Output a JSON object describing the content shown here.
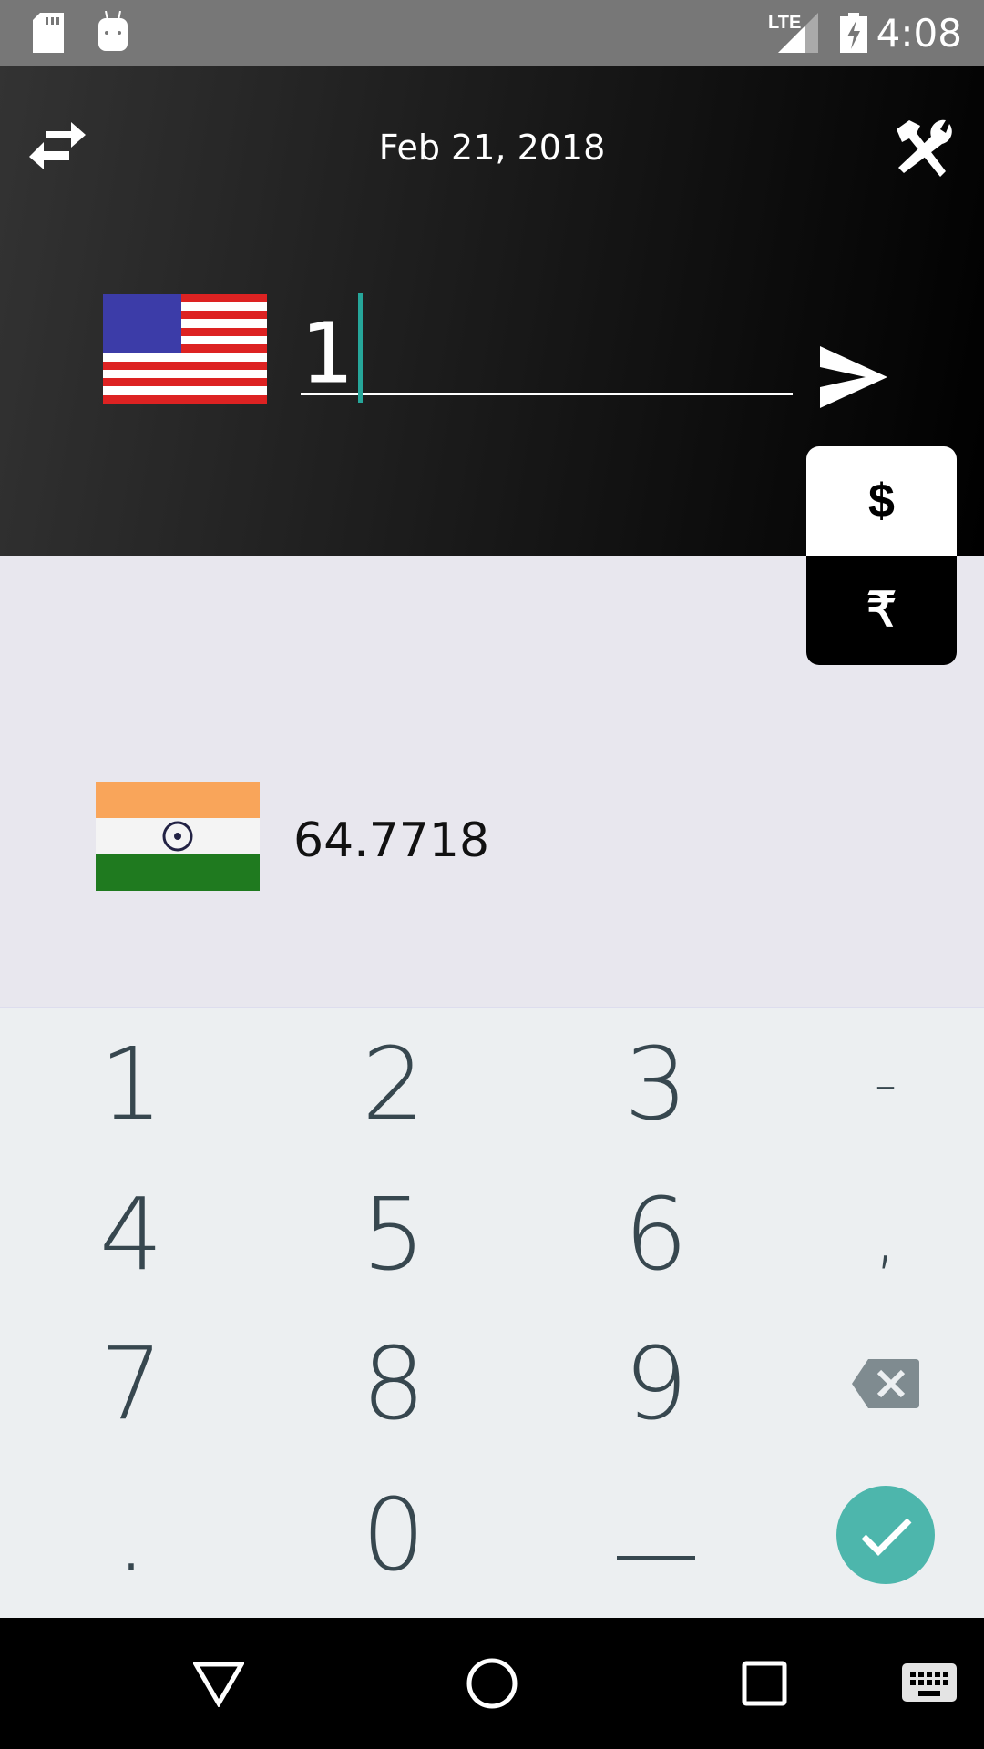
{
  "status_bar": {
    "time": "4:08",
    "network": "LTE"
  },
  "header": {
    "date": "Feb 21, 2018"
  },
  "input": {
    "amount": "1",
    "from_currency": "USD"
  },
  "currency_toggle": {
    "from_symbol": "$",
    "to_symbol": "₹"
  },
  "result": {
    "value": "64.7718",
    "to_currency": "INR"
  },
  "keypad": {
    "keys": [
      "1",
      "2",
      "3",
      "-",
      "4",
      "5",
      "6",
      ",",
      "7",
      "8",
      "9",
      "backspace",
      ".",
      "0",
      "_",
      "done"
    ]
  },
  "colors": {
    "accent": "#26a69a",
    "done_button": "#4db6ac",
    "keypad_bg": "#eceff1",
    "key_text": "#37474f"
  }
}
